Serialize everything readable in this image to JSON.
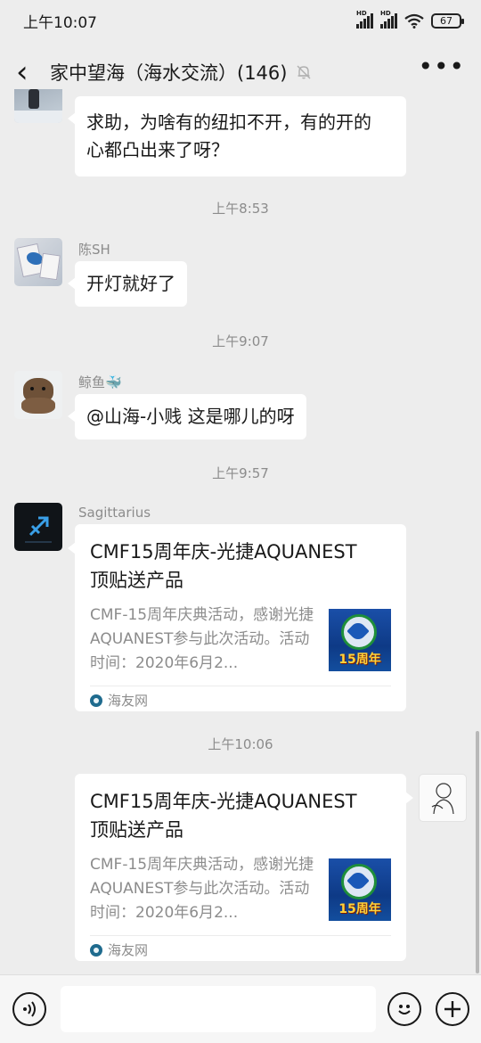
{
  "status_bar": {
    "time": "上午10:07",
    "signal_1": "HD",
    "signal_2": "HD",
    "battery": "67"
  },
  "nav": {
    "back_glyph": "‹",
    "title": "家中望海（海水交流）(146)",
    "more_glyph": "•••",
    "muted": true
  },
  "messages": [
    {
      "type": "text",
      "side": "left",
      "text_line_1": "求助，为啥有的纽扣不开，有的开的",
      "text_line_2": "心都凸出来了呀？"
    },
    {
      "type": "time",
      "text": "上午8:53"
    },
    {
      "type": "text",
      "side": "left",
      "sender": "陈SH",
      "text": "开灯就好了"
    },
    {
      "type": "time",
      "text": "上午9:07"
    },
    {
      "type": "text",
      "side": "left",
      "sender": "鲸鱼🐳",
      "text": "@山海-小贱 这是哪儿的呀"
    },
    {
      "type": "time",
      "text": "上午9:57"
    },
    {
      "type": "card",
      "side": "left",
      "sender": "Sagittarius",
      "title_line_1": "CMF15周年庆-光捷AQUANEST",
      "title_line_2": "顶贴送产品",
      "desc": "CMF-15周年庆典活动，感谢光捷AQUANEST参与此次活动。活动时间：2020年6月2...",
      "thumb_badge": "15周年",
      "source": "海友网"
    },
    {
      "type": "time",
      "text": "上午10:06"
    },
    {
      "type": "card",
      "side": "right",
      "title_line_1": "CMF15周年庆-光捷AQUANEST",
      "title_line_2": "顶贴送产品",
      "desc": "CMF-15周年庆典活动，感谢光捷AQUANEST参与此次活动。活动时间：2020年6月2...",
      "thumb_badge": "15周年",
      "source": "海友网"
    }
  ],
  "input_bar": {
    "voice_icon": "voice-icon",
    "emoji_icon": "emoji-icon",
    "plus_icon": "plus-icon"
  },
  "colors": {
    "background": "#ededed",
    "bubble": "#ffffff",
    "meta_text": "#8c8c8c",
    "text": "#191919"
  }
}
